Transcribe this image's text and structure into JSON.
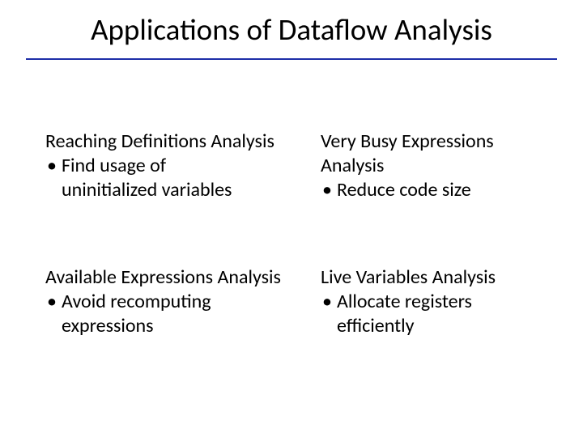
{
  "title": "Applications of Dataflow Analysis",
  "quadrants": {
    "tl": {
      "heading": "Reaching Definitions Analysis",
      "bullet_l1": "Find usage of",
      "bullet_l2": "uninitialized variables"
    },
    "tr": {
      "heading_l1": "Very Busy Expressions",
      "heading_l2": "Analysis",
      "bullet_l1": "Reduce code size"
    },
    "bl": {
      "heading": "Available Expressions Analysis",
      "bullet_l1": "Avoid recomputing",
      "bullet_l2": "expressions"
    },
    "br": {
      "heading": "Live Variables Analysis",
      "bullet_l1": "Allocate registers",
      "bullet_l2": "efficiently"
    }
  }
}
